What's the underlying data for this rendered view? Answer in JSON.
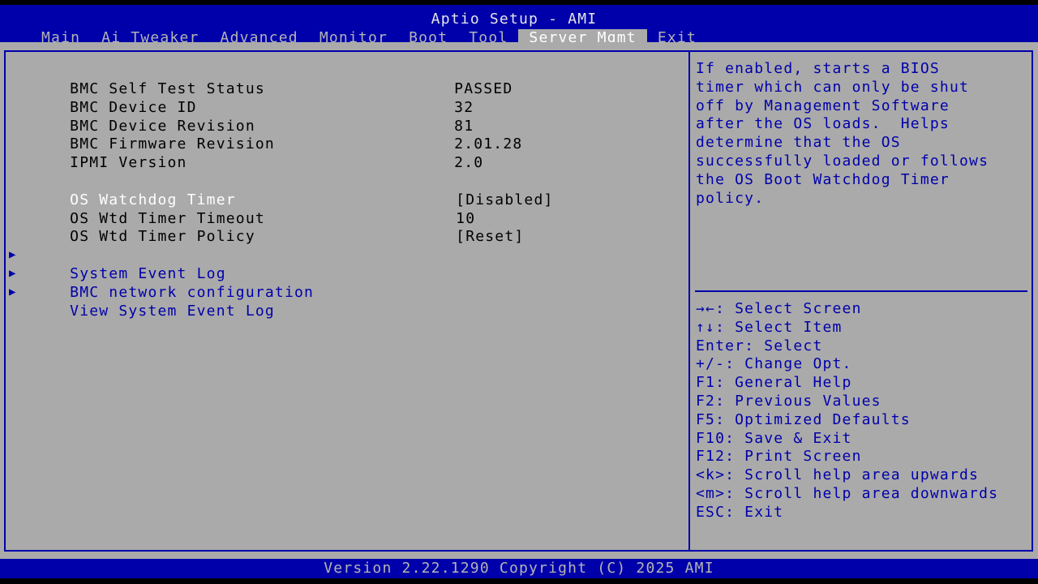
{
  "header": {
    "title": "Aptio Setup - AMI",
    "tabs": [
      "Main",
      "Ai Tweaker",
      "Advanced",
      "Monitor",
      "Boot",
      "Tool",
      "Server Mgmt",
      "Exit"
    ],
    "active_tab": "Server Mgmt"
  },
  "settings": {
    "info": [
      {
        "label": "BMC Self Test Status",
        "value": "PASSED"
      },
      {
        "label": "BMC Device ID",
        "value": "32"
      },
      {
        "label": "BMC Device Revision",
        "value": "81"
      },
      {
        "label": "BMC Firmware Revision",
        "value": "2.01.28"
      },
      {
        "label": "IPMI Version",
        "value": "2.0"
      }
    ],
    "options": [
      {
        "label": "OS Watchdog Timer",
        "value": "[Disabled]"
      },
      {
        "label": "OS Wtd Timer Timeout",
        "value": "10"
      },
      {
        "label": "OS Wtd Timer Policy",
        "value": "[Reset]"
      }
    ],
    "submenus": [
      "System Event Log",
      "BMC network configuration",
      "View System Event Log"
    ]
  },
  "help": {
    "lines": [
      "If enabled, starts a BIOS",
      "timer which can only be shut",
      "off by Management Software",
      "after the OS loads.  Helps",
      "determine that the OS",
      "successfully loaded or follows",
      "the OS Boot Watchdog Timer",
      "policy."
    ]
  },
  "keys": [
    "→←: Select Screen",
    "↑↓: Select Item",
    "Enter: Select",
    "+/-: Change Opt.",
    "F1: General Help",
    "F2: Previous Values",
    "F5: Optimized Defaults",
    "F10: Save & Exit",
    "F12: Print Screen",
    "<k>: Scroll help area upwards",
    "<m>: Scroll help area downwards",
    "ESC: Exit"
  ],
  "footer": {
    "text": "Version 2.22.1290 Copyright (C) 2025 AMI"
  },
  "colors": {
    "background": "#aaaaaa",
    "frame": "#0000aa",
    "help_text": "#0000aa",
    "selected": "#ffffff"
  }
}
